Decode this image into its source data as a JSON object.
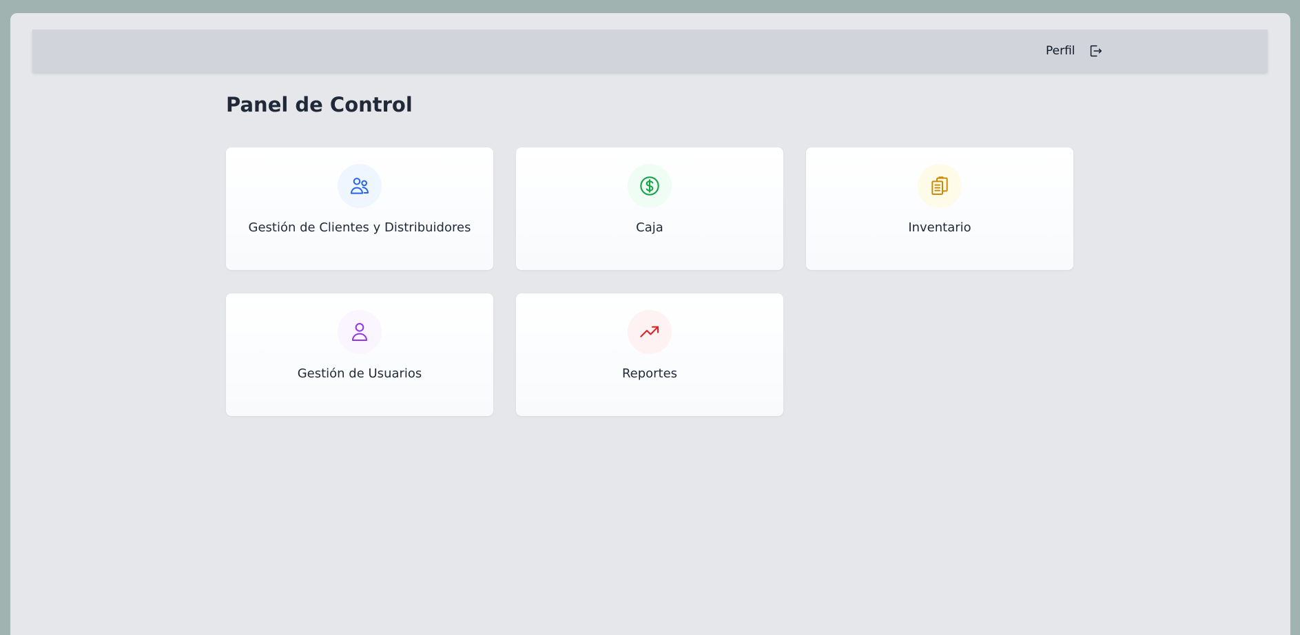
{
  "header": {
    "profile_label": "Perfil",
    "logout_icon": "logout-icon"
  },
  "main": {
    "title": "Panel de Control",
    "cards": [
      {
        "label": "Gestión de Clientes y Distribuidores",
        "icon": "users-icon",
        "icon_color": "#2563eb",
        "icon_bg": "#eff6ff"
      },
      {
        "label": "Caja",
        "icon": "dollar-icon",
        "icon_color": "#16a34a",
        "icon_bg": "#f0fdf4"
      },
      {
        "label": "Inventario",
        "icon": "clipboard-icon",
        "icon_color": "#ca8a04",
        "icon_bg": "#fefce8"
      },
      {
        "label": "Gestión de Usuarios",
        "icon": "user-icon",
        "icon_color": "#9333ea",
        "icon_bg": "#faf5ff"
      },
      {
        "label": "Reportes",
        "icon": "trending-up-icon",
        "icon_color": "#dc2626",
        "icon_bg": "#fef2f2"
      }
    ]
  }
}
